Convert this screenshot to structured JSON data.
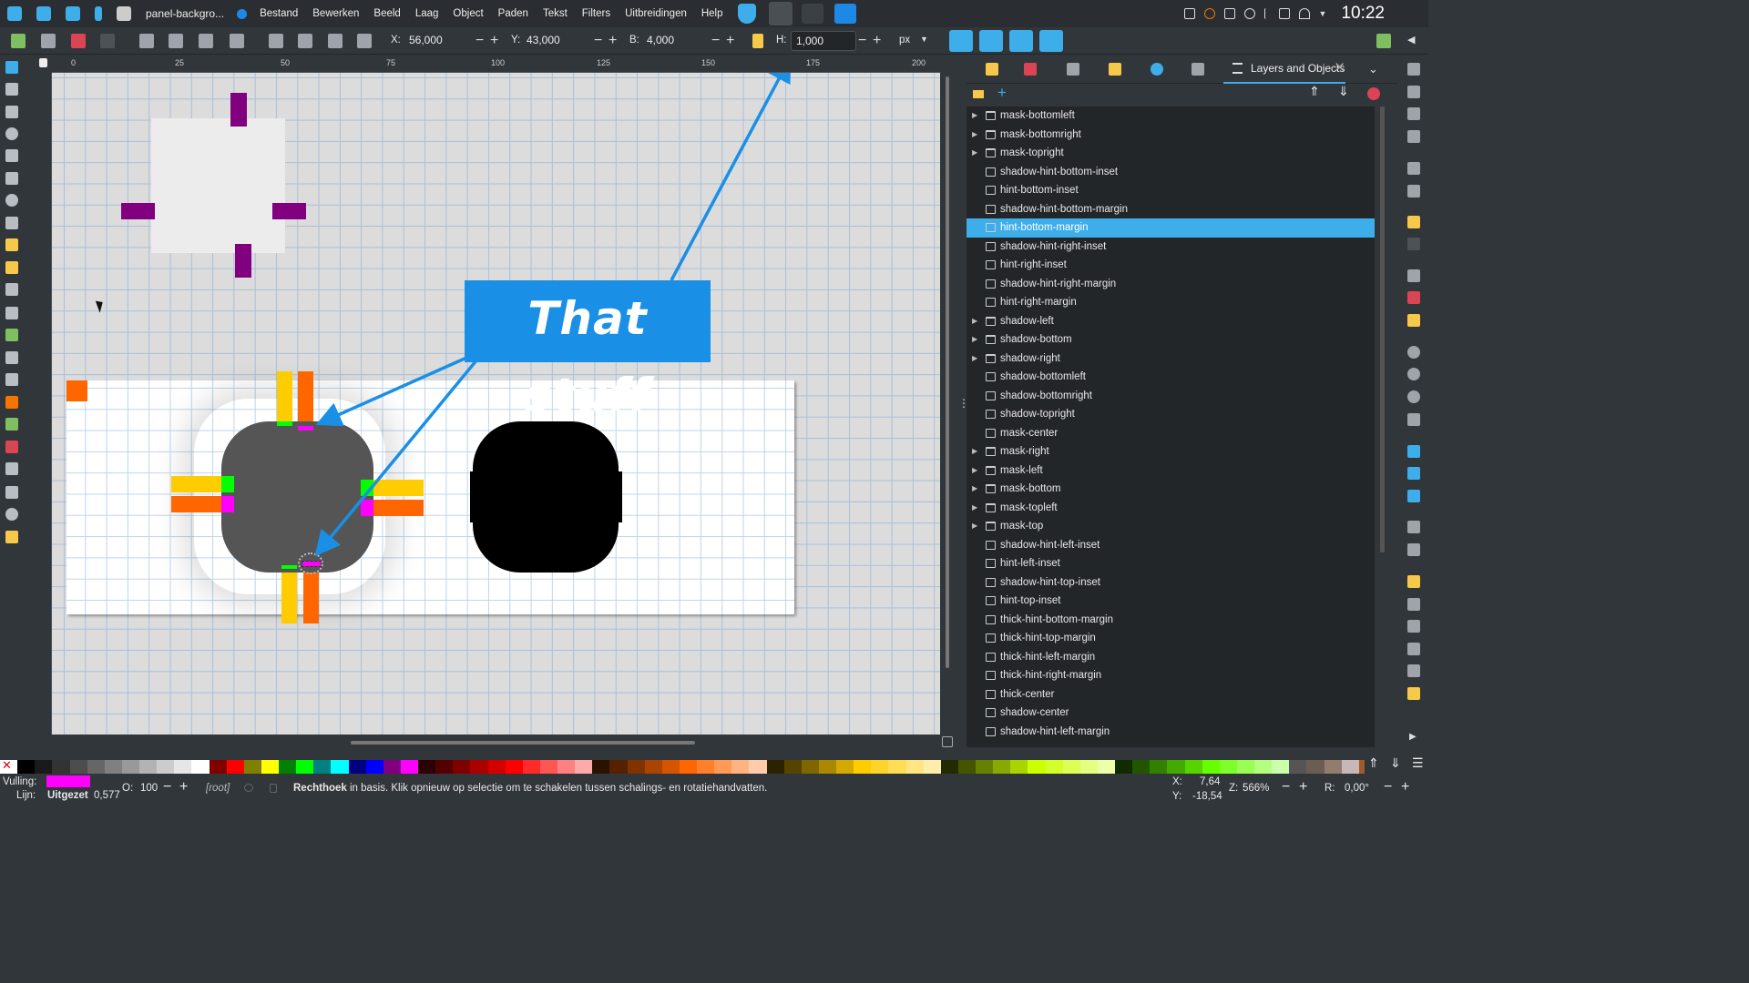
{
  "taskbar": {
    "app_title": "panel-backgro...",
    "menu": [
      "Bestand",
      "Bewerken",
      "Beeld",
      "Laag",
      "Object",
      "Paden",
      "Tekst",
      "Filters",
      "Uitbreidingen",
      "Help"
    ],
    "clock": "10:22"
  },
  "toolbar": {
    "x_label": "X:",
    "x_value": "56,000",
    "y_label": "Y:",
    "y_value": "43,000",
    "w_label": "B:",
    "w_value": "4,000",
    "h_label": "H:",
    "h_value": "1,000",
    "unit": "px"
  },
  "ruler": {
    "ticks": [
      "0",
      "25",
      "50",
      "75",
      "100",
      "125",
      "150",
      "175",
      "200"
    ]
  },
  "canvas": {
    "callout_text": "That stuff"
  },
  "dock": {
    "active_tab": "Layers and Objects"
  },
  "layers": [
    {
      "label": "mask-bottomleft",
      "type": "group"
    },
    {
      "label": "mask-bottomright",
      "type": "group"
    },
    {
      "label": "mask-topright",
      "type": "group"
    },
    {
      "label": "shadow-hint-bottom-inset",
      "type": "rect"
    },
    {
      "label": "hint-bottom-inset",
      "type": "rect"
    },
    {
      "label": "shadow-hint-bottom-margin",
      "type": "rect"
    },
    {
      "label": "hint-bottom-margin",
      "type": "rect",
      "selected": true
    },
    {
      "label": "shadow-hint-right-inset",
      "type": "rect"
    },
    {
      "label": "hint-right-inset",
      "type": "rect"
    },
    {
      "label": "shadow-hint-right-margin",
      "type": "rect"
    },
    {
      "label": "hint-right-margin",
      "type": "rect"
    },
    {
      "label": "shadow-left",
      "type": "group"
    },
    {
      "label": "shadow-bottom",
      "type": "group"
    },
    {
      "label": "shadow-right",
      "type": "group"
    },
    {
      "label": "shadow-bottomleft",
      "type": "image"
    },
    {
      "label": "shadow-bottomright",
      "type": "image"
    },
    {
      "label": "shadow-topright",
      "type": "image"
    },
    {
      "label": "mask-center",
      "type": "rect"
    },
    {
      "label": "mask-right",
      "type": "group"
    },
    {
      "label": "mask-left",
      "type": "group"
    },
    {
      "label": "mask-bottom",
      "type": "group"
    },
    {
      "label": "mask-topleft",
      "type": "group"
    },
    {
      "label": "mask-top",
      "type": "group"
    },
    {
      "label": "shadow-hint-left-inset",
      "type": "rect"
    },
    {
      "label": "hint-left-inset",
      "type": "rect"
    },
    {
      "label": "shadow-hint-top-inset",
      "type": "rect"
    },
    {
      "label": "hint-top-inset",
      "type": "rect"
    },
    {
      "label": "thick-hint-bottom-margin",
      "type": "rect"
    },
    {
      "label": "thick-hint-top-margin",
      "type": "rect"
    },
    {
      "label": "thick-hint-left-margin",
      "type": "rect"
    },
    {
      "label": "thick-hint-right-margin",
      "type": "rect"
    },
    {
      "label": "thick-center",
      "type": "rect"
    },
    {
      "label": "shadow-center",
      "type": "rect"
    },
    {
      "label": "shadow-hint-left-margin",
      "type": "rect"
    }
  ],
  "palette": [
    "#000000",
    "#1a1a1a",
    "#333333",
    "#4d4d4d",
    "#666666",
    "#808080",
    "#999999",
    "#b3b3b3",
    "#cccccc",
    "#e6e6e6",
    "#ffffff",
    "#800000",
    "#ff0000",
    "#808000",
    "#ffff00",
    "#008000",
    "#00ff00",
    "#008080",
    "#00ffff",
    "#000080",
    "#0000ff",
    "#800080",
    "#ff00ff",
    "#2b0000",
    "#550000",
    "#800000",
    "#aa0000",
    "#d40000",
    "#ff0000",
    "#ff2a2a",
    "#ff5555",
    "#ff8080",
    "#ffaaaa",
    "#2b1100",
    "#552200",
    "#803300",
    "#aa4400",
    "#d45500",
    "#ff6600",
    "#ff7f2a",
    "#ff9955",
    "#ffb380",
    "#ffccaa",
    "#2b2200",
    "#554400",
    "#806600",
    "#aa8800",
    "#d4aa00",
    "#ffcc00",
    "#ffd42a",
    "#ffdd55",
    "#ffe680",
    "#ffeeaa",
    "#222b00",
    "#445500",
    "#668000",
    "#88aa00",
    "#aad400",
    "#ccff00",
    "#d4ff2a",
    "#ddff55",
    "#e5ff80",
    "#eeffaa",
    "#112b00",
    "#225500",
    "#338000",
    "#44aa00",
    "#55d400",
    "#66ff00",
    "#7fff2a",
    "#99ff55",
    "#b3ff80",
    "#ccffaa",
    "#555555",
    "#6c5d53",
    "#917c6f",
    "#c8b7b7",
    "#a05a2c",
    "#c87137",
    "#d38d5f",
    "#deaa87"
  ],
  "status": {
    "fill_label": "Vulling:",
    "stroke_label": "Lijn:",
    "stroke_value": "Uitgezet",
    "stroke_width": "0,577",
    "opacity_label": "O:",
    "opacity_value": "100",
    "layer": "[root]",
    "message_bold": "Rechthoek",
    "message": " in basis. Klik opnieuw op selectie om te schakelen tussen schalings- en rotatiehandvatten.",
    "x_label": "X:",
    "x_value": "7,64",
    "y_label": "Y:",
    "y_value": "-18,54",
    "zoom_label": "Z:",
    "zoom_value": "566%",
    "rot_label": "R:",
    "rot_value": "0,00°"
  },
  "colors": {
    "accent": "#3daee9",
    "callout": "#1a8fe6",
    "fill": "#ff00ff",
    "purple": "#800080",
    "yellow": "#ffcc00",
    "orange": "#ff6600",
    "green": "#00ff00",
    "gray": "#555555"
  }
}
